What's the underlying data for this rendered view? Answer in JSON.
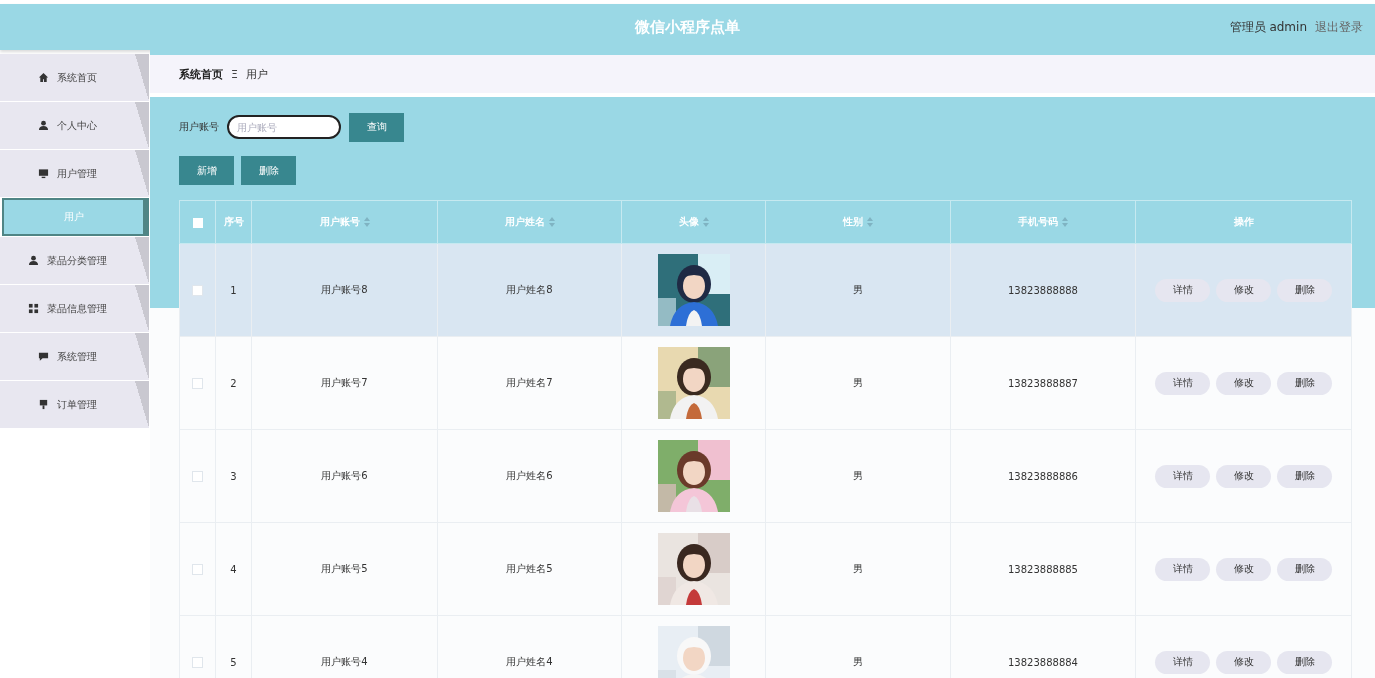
{
  "header": {
    "title": "微信小程序点单",
    "user": "管理员 admin",
    "logout": "退出登录"
  },
  "sidebar": {
    "items": [
      {
        "label": "系统首页",
        "selected": false
      },
      {
        "label": "个人中心",
        "selected": false
      },
      {
        "label": "用户管理",
        "selected": false,
        "children": [
          {
            "label": "用户",
            "selected": true
          }
        ]
      },
      {
        "label": "菜品分类管理",
        "selected": false
      },
      {
        "label": "菜品信息管理",
        "selected": false
      },
      {
        "label": "系统管理",
        "selected": false
      },
      {
        "label": "订单管理",
        "selected": false
      }
    ]
  },
  "breadcrumb": {
    "home": "系统首页",
    "separator": "Ξ",
    "current": "用户"
  },
  "search": {
    "label": "用户账号",
    "placeholder": "用户账号",
    "button": "查询"
  },
  "actions": [
    "新增",
    "删除"
  ],
  "table": {
    "select_all_checked": false,
    "columns": [
      {
        "label": "序号",
        "sortable": false
      },
      {
        "label": "用户账号",
        "sortable": true
      },
      {
        "label": "用户姓名",
        "sortable": true
      },
      {
        "label": "头像",
        "sortable": true
      },
      {
        "label": "性别",
        "sortable": true
      },
      {
        "label": "手机号码",
        "sortable": true
      },
      {
        "label": "操作",
        "sortable": false
      }
    ],
    "rows": [
      {
        "index": "1",
        "account": "用户账号8",
        "name": "用户姓名8",
        "gender": "男",
        "phone": "13823888888",
        "highlighted": true,
        "checked": false,
        "buttons": [
          "详情",
          "修改",
          "删除"
        ]
      },
      {
        "index": "2",
        "account": "用户账号7",
        "name": "用户姓名7",
        "gender": "男",
        "phone": "13823888887",
        "highlighted": false,
        "checked": false,
        "buttons": [
          "详情",
          "修改",
          "删除"
        ]
      },
      {
        "index": "3",
        "account": "用户账号6",
        "name": "用户姓名6",
        "gender": "男",
        "phone": "13823888886",
        "highlighted": false,
        "checked": false,
        "buttons": [
          "详情",
          "修改",
          "删除"
        ]
      },
      {
        "index": "4",
        "account": "用户账号5",
        "name": "用户姓名5",
        "gender": "男",
        "phone": "13823888885",
        "highlighted": false,
        "checked": false,
        "buttons": [
          "详情",
          "修改",
          "删除"
        ]
      },
      {
        "index": "5",
        "account": "用户账号4",
        "name": "用户姓名4",
        "gender": "男",
        "phone": "13823888884",
        "highlighted": false,
        "checked": false,
        "buttons": [
          "详情",
          "修改",
          "删除"
        ]
      }
    ]
  }
}
